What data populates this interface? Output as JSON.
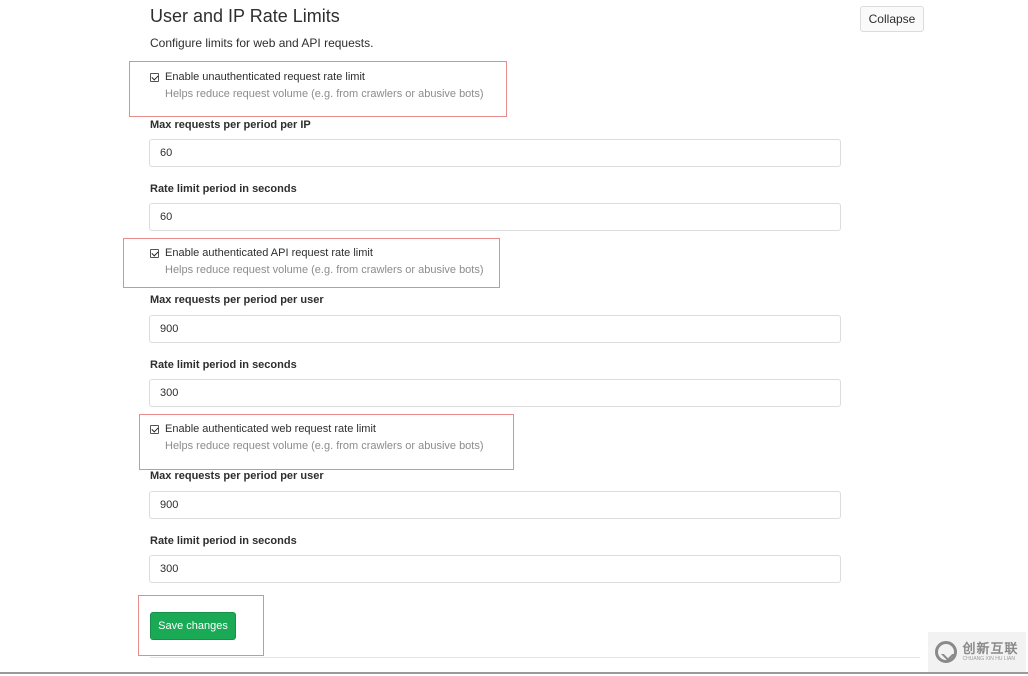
{
  "header": {
    "title": "User and IP Rate Limits",
    "subtitle": "Configure limits for web and API requests.",
    "collapse_label": "Collapse"
  },
  "sections": [
    {
      "checkbox_label": "Enable unauthenticated request rate limit",
      "checkbox_help": "Helps reduce request volume (e.g. from crawlers or abusive bots)",
      "checked": true,
      "max_label": "Max requests per period per IP",
      "max_value": "60",
      "period_label": "Rate limit period in seconds",
      "period_value": "60"
    },
    {
      "checkbox_label": "Enable authenticated API request rate limit",
      "checkbox_help": "Helps reduce request volume (e.g. from crawlers or abusive bots)",
      "checked": true,
      "max_label": "Max requests per period per user",
      "max_value": "900",
      "period_label": "Rate limit period in seconds",
      "period_value": "300"
    },
    {
      "checkbox_label": "Enable authenticated web request rate limit",
      "checkbox_help": "Helps reduce request volume (e.g. from crawlers or abusive bots)",
      "checked": true,
      "max_label": "Max requests per period per user",
      "max_value": "900",
      "period_label": "Rate limit period in seconds",
      "period_value": "300"
    }
  ],
  "save_label": "Save changes",
  "watermark": {
    "main": "创新互联",
    "sub": "CHUANG XIN HU LIAN"
  },
  "colors": {
    "save_button": "#1aaa55",
    "highlight_border": "#e88b8b"
  }
}
